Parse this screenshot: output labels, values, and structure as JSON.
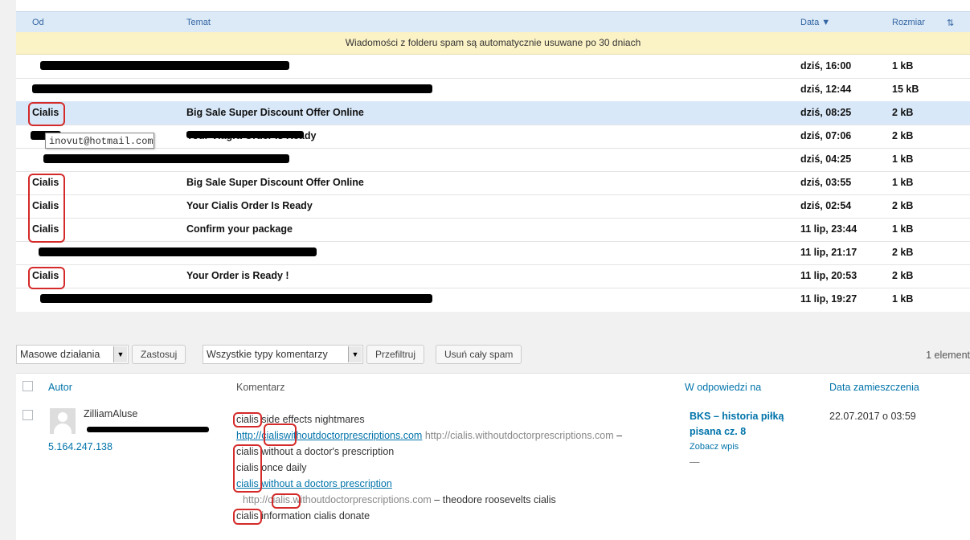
{
  "mail": {
    "columns": {
      "from": "Od",
      "subject": "Temat",
      "date": "Data ▼",
      "size": "Rozmiar"
    },
    "notice": "Wiadomości z folderu spam są automatycznie usuwane po 30 dniach",
    "tooltip": "inovut@hotmail.com",
    "rows": [
      {
        "from": "",
        "subject": "",
        "date": "dziś, 16:00",
        "size": "1 kB"
      },
      {
        "from": "",
        "subject": "",
        "date": "dziś, 12:44",
        "size": "15 kB"
      },
      {
        "from": "Cialis",
        "subject": "Big Sale Super Discount Offer Online",
        "date": "dziś, 08:25",
        "size": "2 kB"
      },
      {
        "from": "",
        "subject": "Your Viagra Order Is Ready",
        "date": "dziś, 07:06",
        "size": "2 kB"
      },
      {
        "from": "",
        "subject": "",
        "date": "dziś, 04:25",
        "size": "1 kB"
      },
      {
        "from": "Cialis",
        "subject": "Big Sale Super Discount Offer Online",
        "date": "dziś, 03:55",
        "size": "1 kB"
      },
      {
        "from": "Cialis",
        "subject": "Your Cialis Order Is Ready",
        "date": "dziś, 02:54",
        "size": "2 kB"
      },
      {
        "from": "Cialis",
        "subject": "Confirm your package",
        "date": "11 lip, 23:44",
        "size": "1 kB"
      },
      {
        "from": "",
        "subject": "",
        "date": "11 lip, 21:17",
        "size": "2 kB"
      },
      {
        "from": "Cialis",
        "subject": "Your Order is Ready !",
        "date": "11 lip, 20:53",
        "size": "2 kB"
      },
      {
        "from": "",
        "subject": "",
        "date": "11 lip, 19:27",
        "size": "1 kB"
      }
    ]
  },
  "wp": {
    "bulk_actions": "Masowe działania",
    "apply": "Zastosuj",
    "comment_types": "Wszystkie typy komentarzy",
    "filter": "Przefiltruj",
    "delete_spam": "Usuń cały spam",
    "count": "1 element",
    "headers": {
      "author": "Autor",
      "comment": "Komentarz",
      "reply_to": "W odpowiedzi na",
      "date": "Data zamieszczenia"
    },
    "author": {
      "name": "ZilliamAluse",
      "ip": "5.164.247.138"
    },
    "comment": {
      "l1_word": "cialis",
      "l1_rest": " side effects nightmares",
      "l2_link": "http://cialiswithoutdoctorprescriptions.com",
      "l2_url": " http://cialis.withoutdoctorprescriptions.com",
      "l2_dash": " –",
      "l3": "cialis without a doctor's prescription",
      "l4": "cialis once daily",
      "l5_link": "cialis without a doctors prescription",
      "l6_url": "http://cialis.withoutdoctorprescriptions.com",
      "l6_rest": " – theodore roosevelts cialis",
      "l7": "cialis information cialis donate"
    },
    "reply": {
      "title_1": "BKS – historia piłką",
      "title_2": "pisana cz. 8",
      "view": "Zobacz wpis",
      "dash": "—"
    },
    "date": "22.07.2017 o 03:59"
  }
}
